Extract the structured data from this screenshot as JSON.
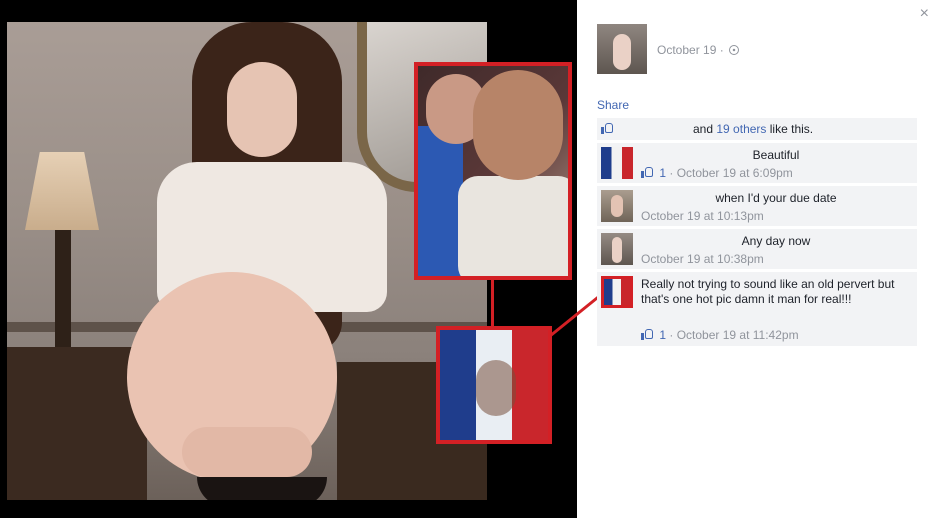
{
  "window": {
    "close_glyph": "×"
  },
  "post": {
    "date": "October 19",
    "separator": "·",
    "privacy_icon": "globe-icon",
    "share_label": "Share"
  },
  "likes": {
    "prefix": "and",
    "others": "19 others",
    "suffix": "like this."
  },
  "comments": [
    {
      "text": "Beautiful",
      "likes": "1",
      "time": "October 19 at 6:09pm",
      "avatar": "french-flag-avatar"
    },
    {
      "text": "when I'd your due date",
      "time": "October 19 at 10:13pm",
      "avatar": "woman-avatar"
    },
    {
      "text": "Any day now",
      "time": "October 19 at 10:38pm",
      "avatar": "poster-avatar"
    },
    {
      "text": "Really not trying to sound like an old pervert but that's one hot pic damn it man for real!!!",
      "likes": "1",
      "time": "October 19 at 11:42pm",
      "avatar": "french-flag-avatar"
    }
  ],
  "colors": {
    "highlight": "#d32025",
    "link": "#4267b2",
    "meta": "#90949c",
    "comment_bg": "#f2f3f5"
  }
}
